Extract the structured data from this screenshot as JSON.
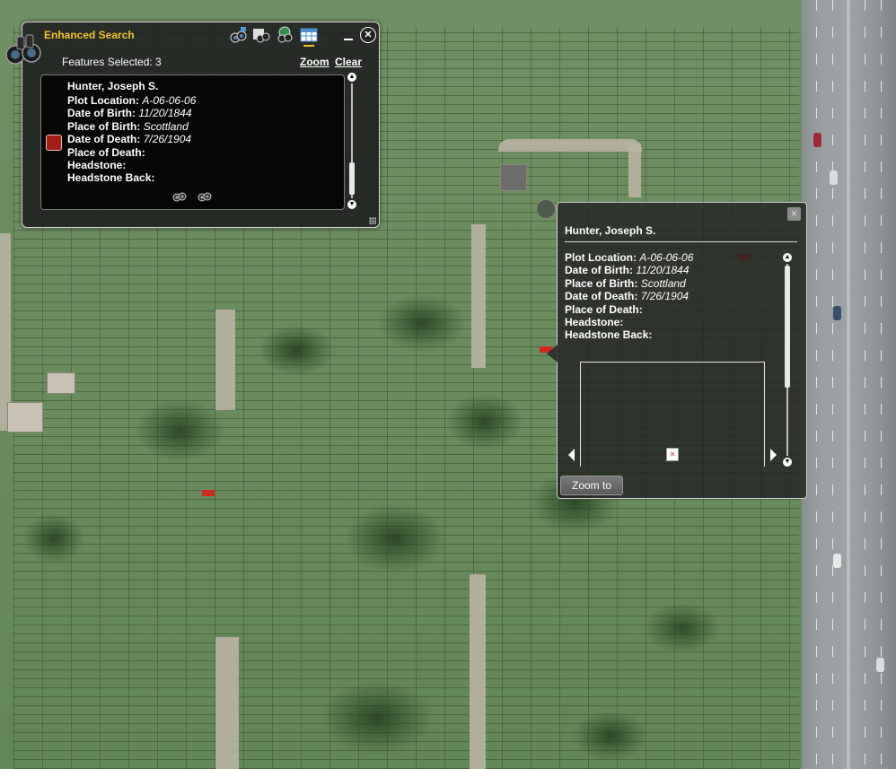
{
  "search_panel": {
    "title": "Enhanced Search",
    "features_selected": "Features Selected: 3",
    "zoom_label": "Zoom",
    "clear_label": "Clear",
    "tools": [
      "search-by-graphic-icon",
      "search-by-attribute-icon",
      "search-by-spatial-icon",
      "results-table-icon"
    ],
    "result": {
      "name": "Hunter, Joseph S.",
      "swatch_color": "#a51d14",
      "attributes": [
        {
          "label": "Plot Location:",
          "value": "A-06-06-06"
        },
        {
          "label": "Date of Birth:",
          "value": "11/20/1844"
        },
        {
          "label": "Place of Birth:",
          "value": "Scottland"
        },
        {
          "label": "Date of Death:",
          "value": "7/26/1904"
        },
        {
          "label": "Place of Death:",
          "value": ""
        },
        {
          "label": "Headstone:",
          "value": ""
        },
        {
          "label": "Headstone Back:",
          "value": ""
        }
      ]
    }
  },
  "popup": {
    "title": "Hunter, Joseph S.",
    "close_glyph": "×",
    "attributes": [
      {
        "label": "Plot Location:",
        "value": "A-06-06-06"
      },
      {
        "label": "Date of Birth:",
        "value": "11/20/1844"
      },
      {
        "label": "Place of Birth:",
        "value": "Scottland"
      },
      {
        "label": "Date of Death:",
        "value": "7/26/1904"
      },
      {
        "label": "Place of Death:",
        "value": ""
      },
      {
        "label": "Headstone:",
        "value": ""
      },
      {
        "label": "Headstone Back:",
        "value": ""
      }
    ],
    "zoom_to_label": "Zoom to"
  },
  "colors": {
    "accent_title": "#f3c52b",
    "highlight_plot": "#d2281e"
  }
}
